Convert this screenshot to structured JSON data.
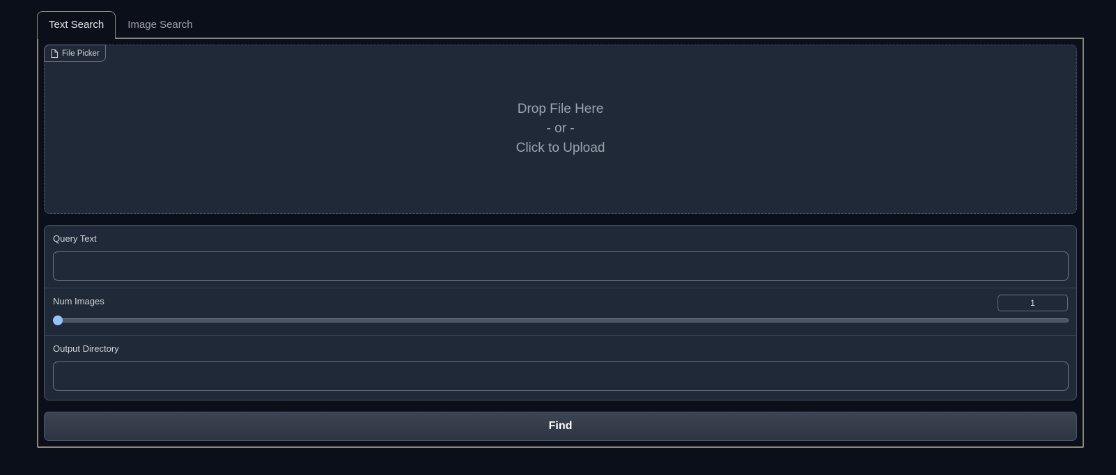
{
  "tabs": [
    {
      "label": "Text Search",
      "selected": true
    },
    {
      "label": "Image Search",
      "selected": false
    }
  ],
  "file_picker": {
    "label": "File Picker",
    "icon": "file-icon",
    "drop_line1": "Drop File Here",
    "drop_line2": "- or -",
    "drop_line3": "Click to Upload"
  },
  "query": {
    "label": "Query Text",
    "value": ""
  },
  "num_images": {
    "label": "Num Images",
    "value": "1",
    "fraction": 0
  },
  "output_dir": {
    "label": "Output Directory",
    "value": ""
  },
  "find_button": {
    "label": "Find"
  },
  "colors": {
    "background": "#0b0f19",
    "panel": "#1f2937",
    "slider_accent": "#93c5fd"
  }
}
